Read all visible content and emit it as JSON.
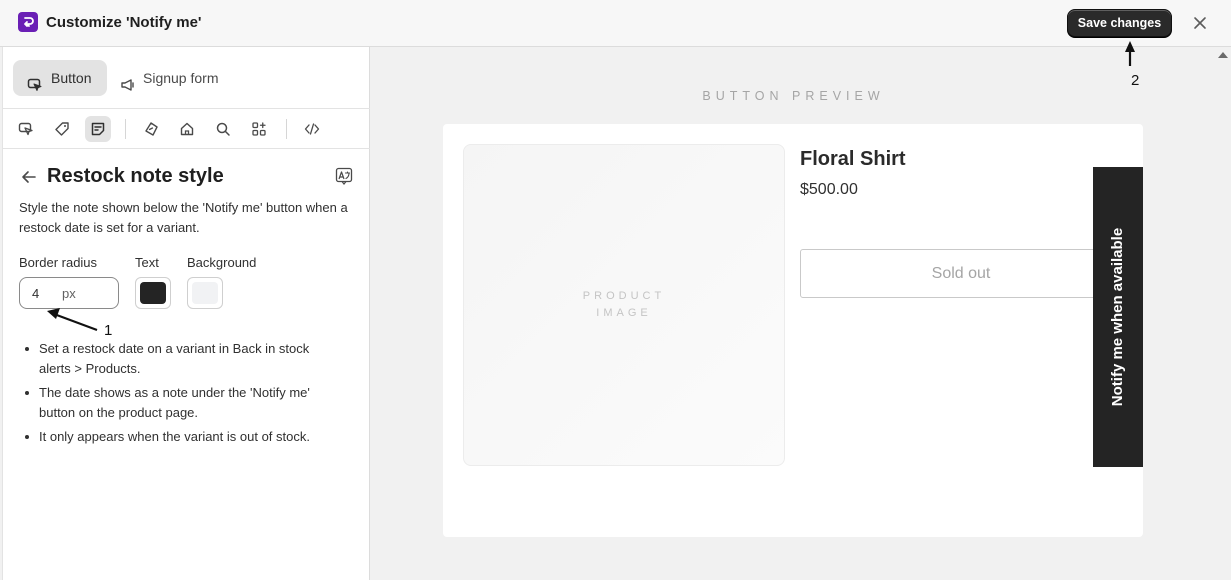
{
  "header": {
    "title": "Customize 'Notify me'",
    "save_label": "Save changes",
    "close_icon": "close-icon",
    "logo_color": "#6a1fb5"
  },
  "sidebar": {
    "tabs": [
      {
        "label": "Button",
        "icon": "cursor-click-icon",
        "active": true
      },
      {
        "label": "Signup form",
        "icon": "megaphone-icon",
        "active": false
      }
    ],
    "tools": [
      {
        "icon": "cursor-icon",
        "active": false
      },
      {
        "icon": "tag-icon",
        "active": false
      },
      {
        "icon": "note-icon",
        "active": true
      },
      {
        "icon": "price-tag-icon",
        "active": false
      },
      {
        "icon": "home-icon",
        "active": false
      },
      {
        "icon": "search-icon",
        "active": false
      },
      {
        "icon": "apps-icon",
        "active": false
      },
      {
        "icon": "code-icon",
        "active": false
      }
    ],
    "section_title": "Restock note style",
    "description": "Style the note shown below the 'Notify me' button when a restock date is set for a variant.",
    "fields": {
      "border_radius_label": "Border radius",
      "border_radius_value": "4",
      "border_radius_unit": "px",
      "text_label": "Text",
      "text_color": "#242424",
      "background_label": "Background",
      "background_color": "#f1f2f4"
    },
    "tips": [
      "Set a restock date on a variant in Back in stock alerts > Products.",
      "The date shows as a note under the 'Notify me' button on the product page.",
      "It only appears when the variant is out of stock."
    ]
  },
  "preview": {
    "label": "BUTTON PREVIEW",
    "product_image_text_line1": "PRODUCT",
    "product_image_text_line2": "IMAGE",
    "product_name": "Floral Shirt",
    "product_price": "$500.00",
    "sold_out_label": "Sold out",
    "notify_tab_label": "Notify me when available"
  },
  "annotations": {
    "marker_1": "1",
    "marker_2": "2"
  }
}
